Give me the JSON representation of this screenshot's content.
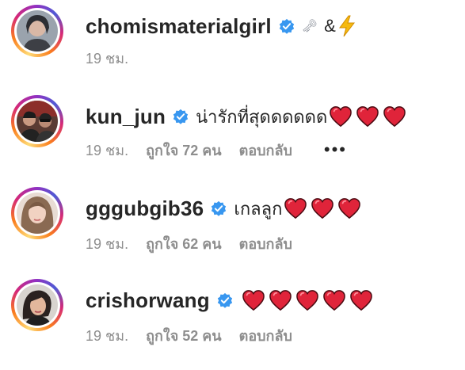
{
  "colors": {
    "username": "#262626",
    "meta": "#8e8e8e",
    "verified": "#3897f0",
    "heart": "#e0243a"
  },
  "comments": [
    {
      "username": "chomismaterialgirl",
      "text": "&",
      "emojis": [
        "🗝",
        "⚡"
      ],
      "time": "19 ชม.",
      "likes": "",
      "reply": ""
    },
    {
      "username": "kun_jun",
      "text": "น่ารักที่สุดดดดดด",
      "hearts": 3,
      "time": "19 ชม.",
      "likes": "ถูกใจ 72 คน",
      "reply": "ตอบกลับ",
      "more": "•••"
    },
    {
      "username": "gggubgib36",
      "text": "เกลลูก",
      "hearts": 3,
      "time": "19 ชม.",
      "likes": "ถูกใจ 62 คน",
      "reply": "ตอบกลับ"
    },
    {
      "username": "crishorwang",
      "text": "",
      "hearts": 5,
      "time": "19 ชม.",
      "likes": "ถูกใจ 52 คน",
      "reply": "ตอบกลับ"
    }
  ]
}
